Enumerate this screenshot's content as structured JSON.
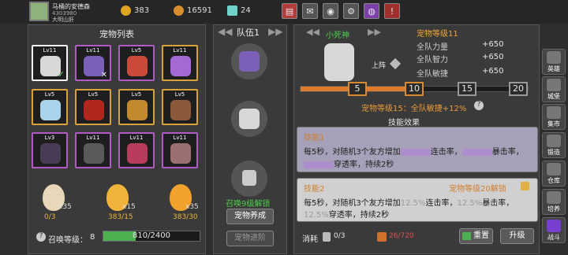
{
  "player": {
    "name": "马桶的安德森",
    "id": "4303980",
    "status": "大明山肝"
  },
  "resources": {
    "gold": "383",
    "gems": "16591",
    "diamonds": "24"
  },
  "pet_list": {
    "title": "宠物列表",
    "levels": [
      "Lv11",
      "Lv11",
      "Lv5",
      "Lv11",
      "Lv5",
      "Lv5",
      "Lv5",
      "Lv5",
      "Lv3",
      "Lv11",
      "Lv11",
      "Lv11"
    ]
  },
  "eggs": [
    {
      "count": "x35",
      "progress": "0/3"
    },
    {
      "count": "x15",
      "progress": "383/15"
    },
    {
      "count": "x35",
      "progress": "383/30"
    }
  ],
  "summon": {
    "label": "召唤等级：",
    "level": "8",
    "exp": "810/2400",
    "exp_fraction": 0.3375
  },
  "team": {
    "title": "队伍1",
    "unlock_text": "召唤9级解锁",
    "btn_build": "宠物养成",
    "btn_transform": "宠物进阶"
  },
  "pet": {
    "name": "小死神",
    "grade": "宠物等级11",
    "status": "上阵",
    "stats": [
      {
        "label": "全队力量",
        "value": "+650"
      },
      {
        "label": "全队智力",
        "value": "+650"
      },
      {
        "label": "全队敏捷",
        "value": "+650"
      }
    ],
    "milestones": [
      "5",
      "10",
      "15",
      "20"
    ],
    "progress_fraction": 0.52,
    "milestone_text": "宠物等级15：全队敏捷+12%"
  },
  "skills": {
    "title": "技能效果",
    "s1_title": "技能1",
    "s1_line1a": "每5秒，对随机3个友方增加",
    "s1_line1b": "连击率，",
    "s1_line1c": "暴击率，",
    "s1_line2": "穿透率，持续2秒",
    "s2_title": "技能2",
    "s2_unlock": "宠物等级20解锁",
    "s2_line1a": "每5秒，对随机3个友方增加",
    "s2_v1": "12.5%",
    "s2_line1b": "连击率，",
    "s2_v2": "12.5%",
    "s2_line1c": "暴击率，",
    "s2_v3": "12.5%",
    "s2_line2": "穿透率，持续2秒"
  },
  "consume": {
    "label": "消耗",
    "item1": "0/3",
    "item2": "26/720",
    "btn_reset": "重置",
    "btn_upgrade": "升级"
  },
  "sidebar": [
    "英雄",
    "城堡",
    "集市",
    "锻造",
    "仓库",
    "培养",
    "战斗"
  ]
}
